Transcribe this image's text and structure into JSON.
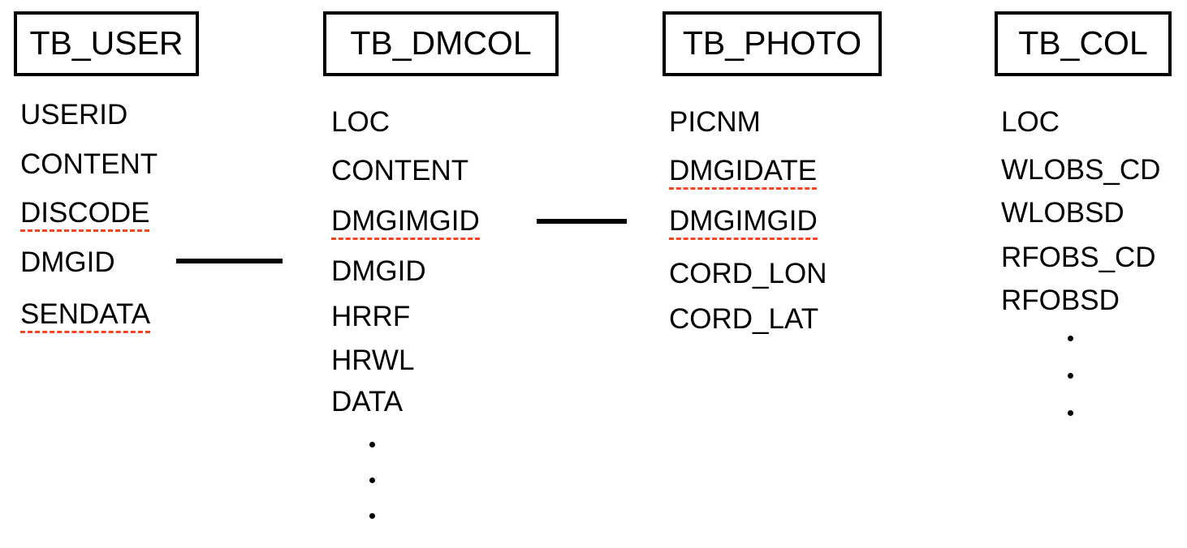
{
  "diagram": {
    "title": "Database table relationship diagram",
    "colors": {
      "line": "#000000",
      "text": "#000000",
      "background": "#ffffff",
      "misspelled_underline": "#f8441f"
    },
    "entities": [
      {
        "name": "TB_USER",
        "fields": [
          {
            "label": "USERID",
            "misspelled": false
          },
          {
            "label": "CONTENT",
            "misspelled": false
          },
          {
            "label": "DISCODE",
            "misspelled": true
          },
          {
            "label": "DMGID",
            "misspelled": false
          },
          {
            "label": "SENDATA",
            "misspelled": true
          }
        ],
        "ellipsis": 0
      },
      {
        "name": "TB_DMCOL",
        "fields": [
          {
            "label": "LOC",
            "misspelled": false
          },
          {
            "label": "CONTENT",
            "misspelled": false
          },
          {
            "label": "DMGIMGID",
            "misspelled": true
          },
          {
            "label": "DMGID",
            "misspelled": false
          },
          {
            "label": "HRRF",
            "misspelled": false
          },
          {
            "label": "HRWL",
            "misspelled": false
          },
          {
            "label": "DATA",
            "misspelled": false
          }
        ],
        "ellipsis": 3
      },
      {
        "name": "TB_PHOTO",
        "fields": [
          {
            "label": "PICNM",
            "misspelled": false
          },
          {
            "label": "DMGIDATE",
            "misspelled": true
          },
          {
            "label": "DMGIMGID",
            "misspelled": true
          },
          {
            "label": "CORD_LON",
            "misspelled": false
          },
          {
            "label": "CORD_LAT",
            "misspelled": false
          }
        ],
        "ellipsis": 0
      },
      {
        "name": "TB_COL",
        "fields": [
          {
            "label": "LOC",
            "misspelled": false
          },
          {
            "label": "WLOBS_CD",
            "misspelled": false
          },
          {
            "label": "WLOBSD",
            "misspelled": false
          },
          {
            "label": "RFOBS_CD",
            "misspelled": false
          },
          {
            "label": "RFOBSD",
            "misspelled": false
          }
        ],
        "ellipsis": 3
      }
    ],
    "relationships": [
      {
        "from": "TB_USER.DMGID",
        "to": "TB_DMCOL.DMGIMGID"
      },
      {
        "from": "TB_DMCOL.DMGIMGID",
        "to": "TB_PHOTO.DMGIMGID"
      }
    ]
  }
}
